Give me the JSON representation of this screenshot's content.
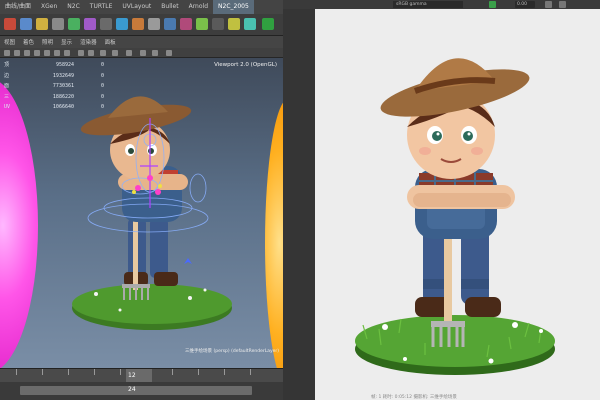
{
  "maya": {
    "shelf_tabs": [
      "曲线/曲面",
      "XGen",
      "N2C",
      "TURTLE",
      "UVLayout",
      "Bullet",
      "Arnold",
      "N2C_2005"
    ],
    "active_shelf_tab": "N2C_2005",
    "viewport_menu": [
      "视图",
      "着色",
      "照明",
      "显示",
      "渲染器",
      "面板"
    ],
    "hud": [
      {
        "k": "顶",
        "v": "958924",
        "z": "0"
      },
      {
        "k": "边",
        "v": "1932649",
        "z": "0"
      },
      {
        "k": "面",
        "v": "7730361",
        "z": "0"
      },
      {
        "k": "三",
        "v": "1886220",
        "z": "0"
      },
      {
        "k": "UV",
        "v": "1066640",
        "z": "0"
      }
    ],
    "viewport_renderer": "Viewport 2.0 (OpenGL)",
    "camera_label": "三维手绘场景 (persp) (defaultRenderLayer)",
    "timeline_current": "12",
    "range_end": "24"
  },
  "render_view": {
    "display_field": "sRGB gamma",
    "exposure": "0.00",
    "caption": "帧: 1   耗时: 0:05:12   摄影机: 三维手绘场景"
  },
  "colors": {
    "maya_bg": "#3a3a3a",
    "active_tab": "#5a6b7a",
    "light_magenta": "#ff55e8",
    "light_orange": "#ffb020",
    "render_bg": "#ededed"
  }
}
